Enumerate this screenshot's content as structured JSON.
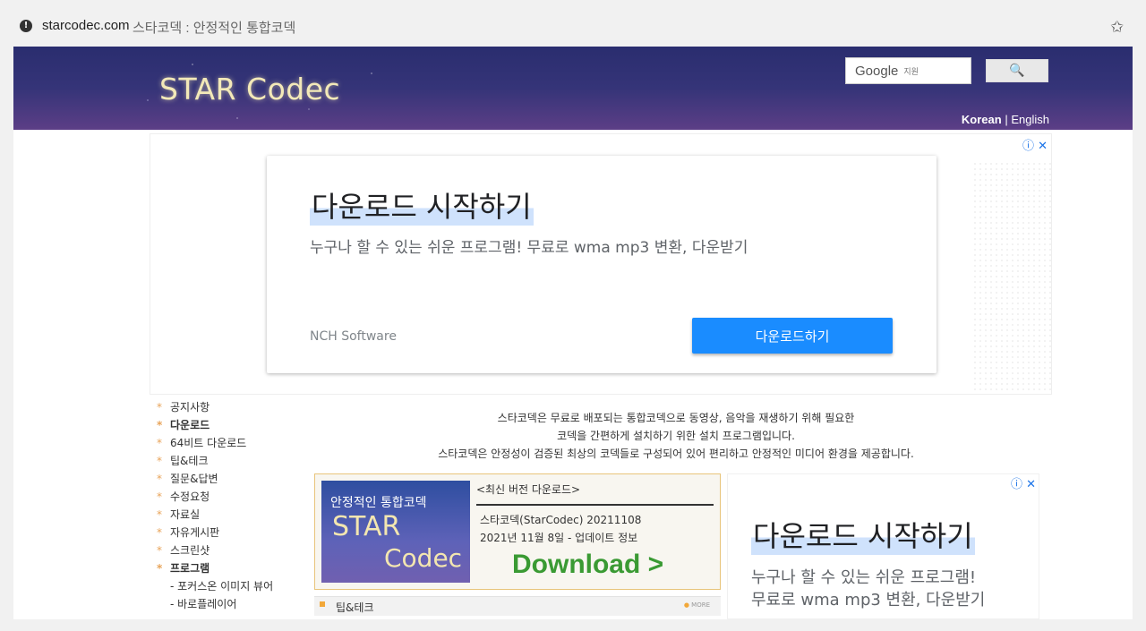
{
  "browser": {
    "domain": "starcodec.com",
    "title": "스타코덱 : 안정적인 통합코덱"
  },
  "header": {
    "logo": "STAR Codec",
    "search_brand": "Google",
    "search_hint": "지원",
    "search_button": "🔍",
    "lang_korean": "Korean",
    "lang_sep": "|",
    "lang_english": "English"
  },
  "top_ad": {
    "headline": "다운로드 시작하기",
    "subtitle": "누구나 할 수 있는 쉬운 프로그램! 무료로 wma mp3 변환, 다운받기",
    "advertiser": "NCH Software",
    "button": "다운로드하기",
    "icons": "ⓘ ✕"
  },
  "sidebar": {
    "items": [
      {
        "label": "공지사항",
        "bold": false
      },
      {
        "label": "다운로드",
        "bold": true
      },
      {
        "label": "64비트 다운로드",
        "bold": false
      },
      {
        "label": "팁&테크",
        "bold": false
      },
      {
        "label": "질문&답변",
        "bold": false
      },
      {
        "label": "수정요청",
        "bold": false
      },
      {
        "label": "자료실",
        "bold": false
      },
      {
        "label": "자유게시판",
        "bold": false
      },
      {
        "label": "스크린샷",
        "bold": false
      },
      {
        "label": "프로그램",
        "bold": true
      }
    ],
    "subitems": [
      "- 포커스온 이미지 뷰어",
      "- 바로플레이어"
    ]
  },
  "intro": {
    "line1": "스타코덱은 무료로 배포되는 통합코덱으로 동영상, 음악을 재생하기 위해 필요한",
    "line2": "코덱을 간편하게 설치하기 위한 설치 프로그램입니다.",
    "line3": "스타코덱은 안정성이 검증된 최상의 코덱들로 구성되어 있어 편리하고 안정적인 미디어 환경을 제공합니다."
  },
  "download_box": {
    "img_line1": "안정적인 통합코덱",
    "img_line2": "STAR",
    "img_line3": "Codec",
    "header": "<최신 버전 다운로드>",
    "version": "스타코덱(StarCodec) 20211108",
    "update": "2021년 11월 8일 - 업데이트 정보",
    "download": "Download >"
  },
  "tip_bar": {
    "label": "팁&테크",
    "more": "MORE"
  },
  "side_ad": {
    "headline": "다운로드 시작하기",
    "line1": "누구나 할 수 있는 쉬운 프로그램!",
    "line2": "무료로 wma mp3 변환, 다운받기",
    "icons": "ⓘ ✕"
  }
}
